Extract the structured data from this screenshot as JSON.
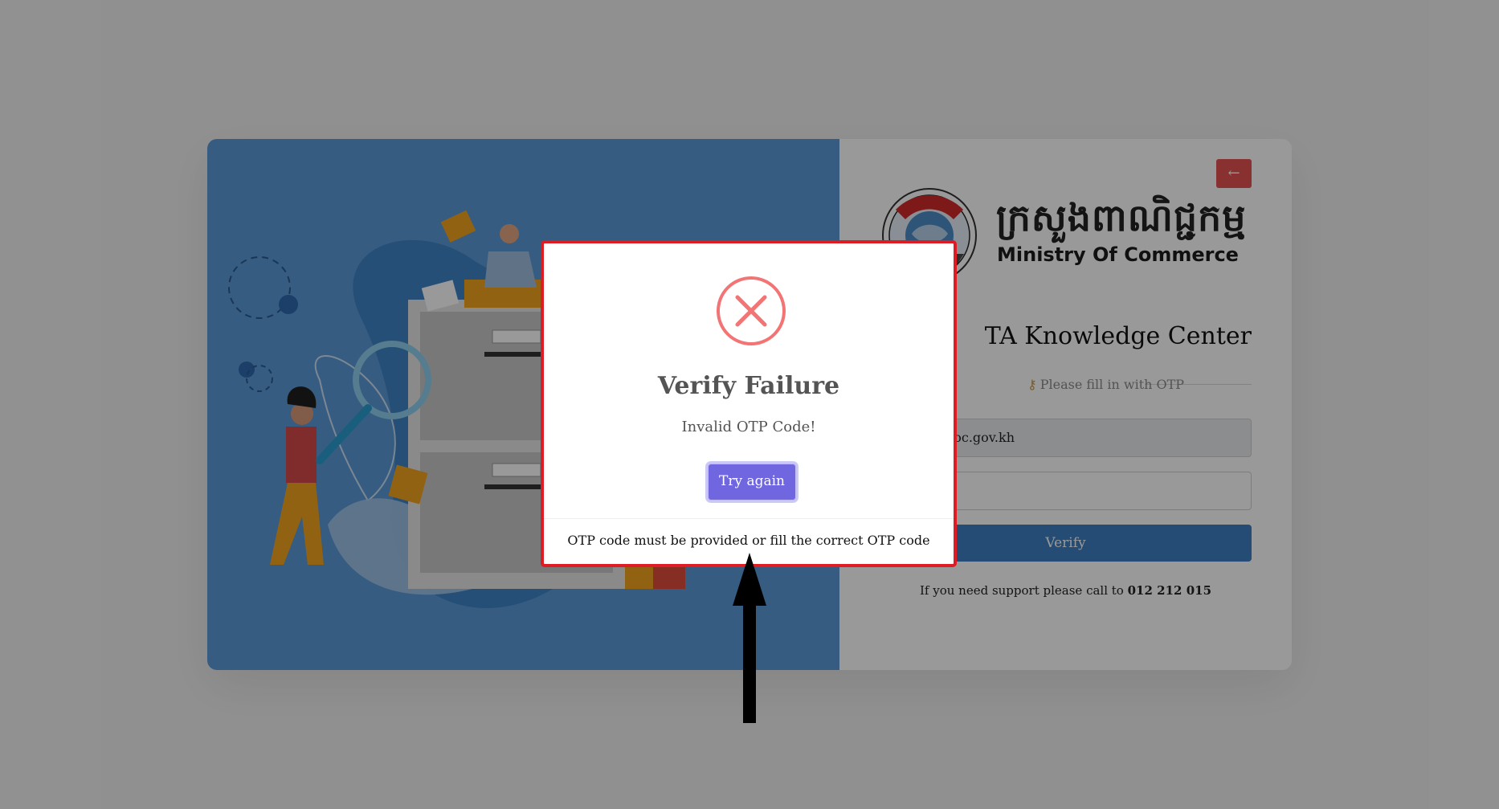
{
  "login_page": {
    "back_button_icon": "arrow-left-icon",
    "logo": {
      "khmer_text": "ក្រសួងពាណិជ្ជកម្ម",
      "english_text": "Ministry Of Commerce"
    },
    "title": "TA Knowledge Center",
    "hint": {
      "icon": "key-icon",
      "text": "Please fill in with OTP"
    },
    "email_value": "nthea@moc.gov.kh",
    "otp_value": "",
    "verify_label": "Verify",
    "support_text": "If you need support please call to",
    "support_phone": "012 212 015"
  },
  "modal": {
    "icon": "error-x-icon",
    "title": "Verify Failure",
    "message": "Invalid OTP Code!",
    "button_label": "Try again",
    "footer": "OTP code must be provided or fill the correct OTP code"
  },
  "colors": {
    "illustration_bg": "#5b9ad8",
    "primary_blue": "#3d7fc2",
    "danger_red": "#e45050",
    "modal_border": "#dd1c24",
    "button_purple": "#7066e0",
    "error_icon": "#f27474"
  }
}
